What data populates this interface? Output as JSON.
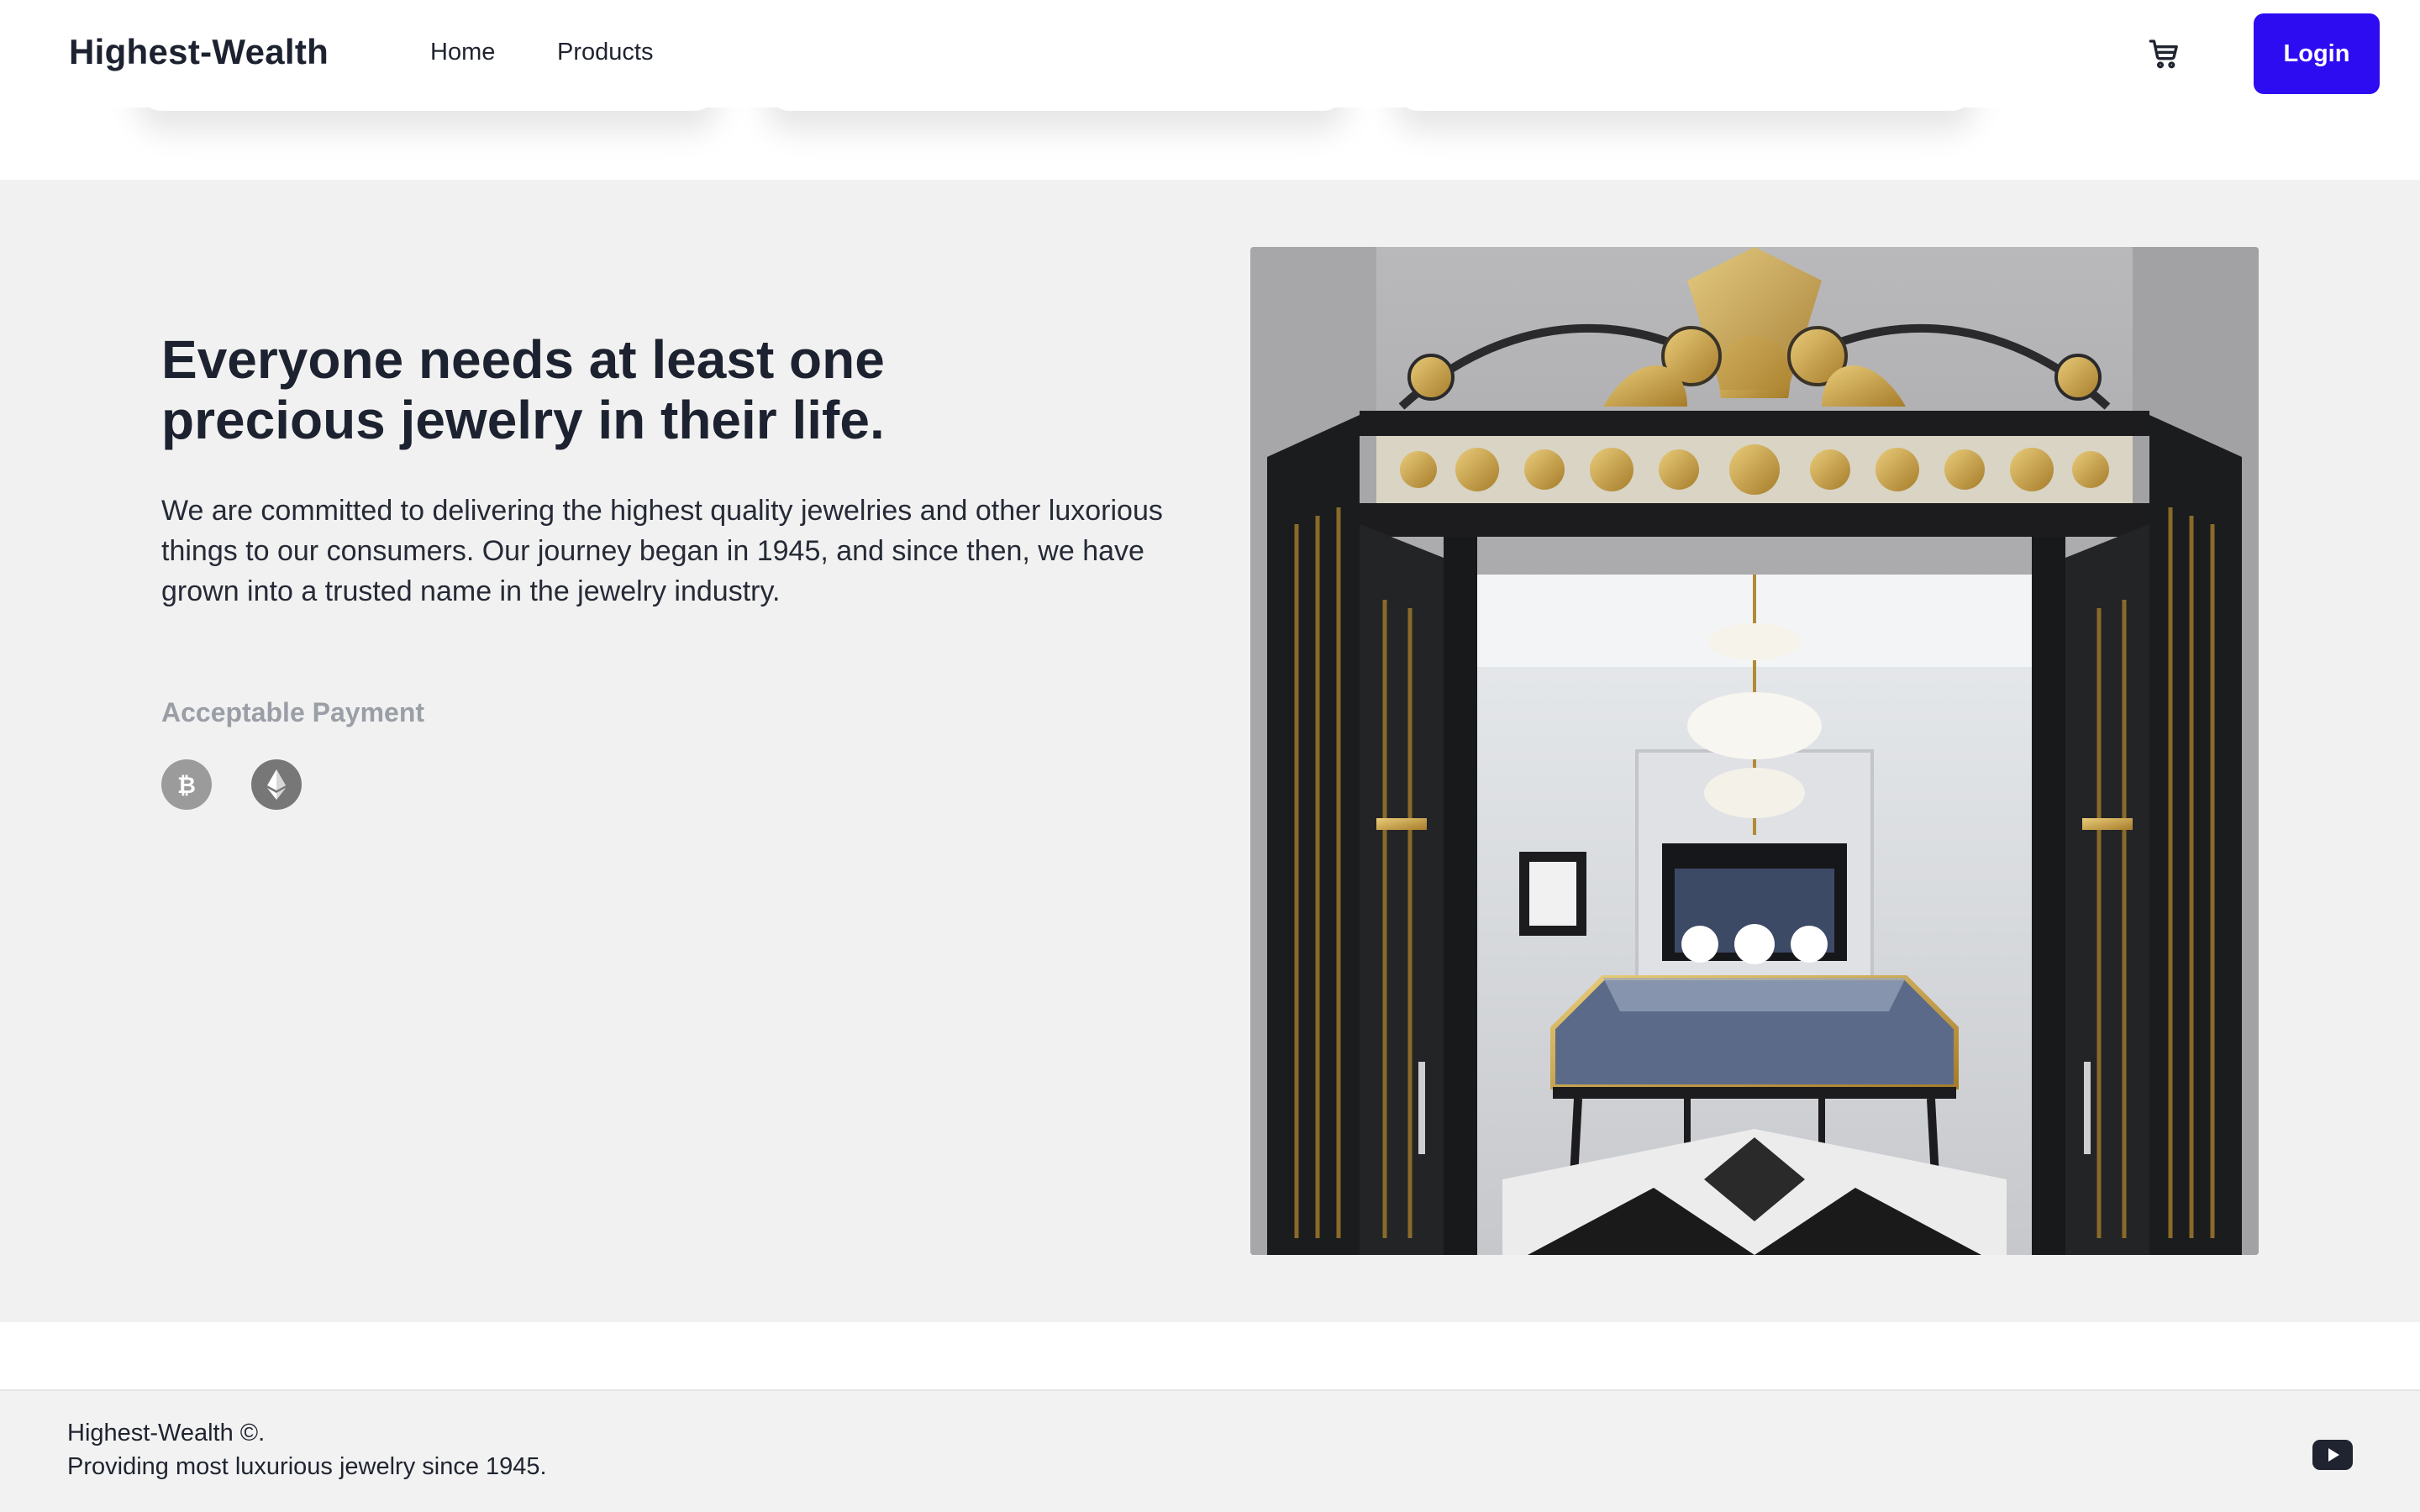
{
  "header": {
    "brand": "Highest-Wealth",
    "nav": [
      "Home",
      "Products"
    ],
    "cart_icon": "shopping-cart-icon",
    "login_label": "Login",
    "accent_color": "#2d0cf2"
  },
  "hero": {
    "headline_line1": "Everyone needs at least one",
    "headline_line2": "precious jewelry in their life.",
    "lead": "We are committed to delivering the highest quality jewelries and other luxorious things to our consumers. Our journey began in 1945, and since then, we have grown into a trusted name in the jewelry industry.",
    "payment_label": "Acceptable Payment",
    "payment_icons": [
      "bitcoin-icon",
      "ethereum-icon"
    ],
    "image": "jewelry-store-entrance-photo"
  },
  "footer": {
    "line1": "Highest-Wealth ©.",
    "line2": "Providing most luxurious jewelry since 1945.",
    "social_icon": "youtube-icon"
  }
}
